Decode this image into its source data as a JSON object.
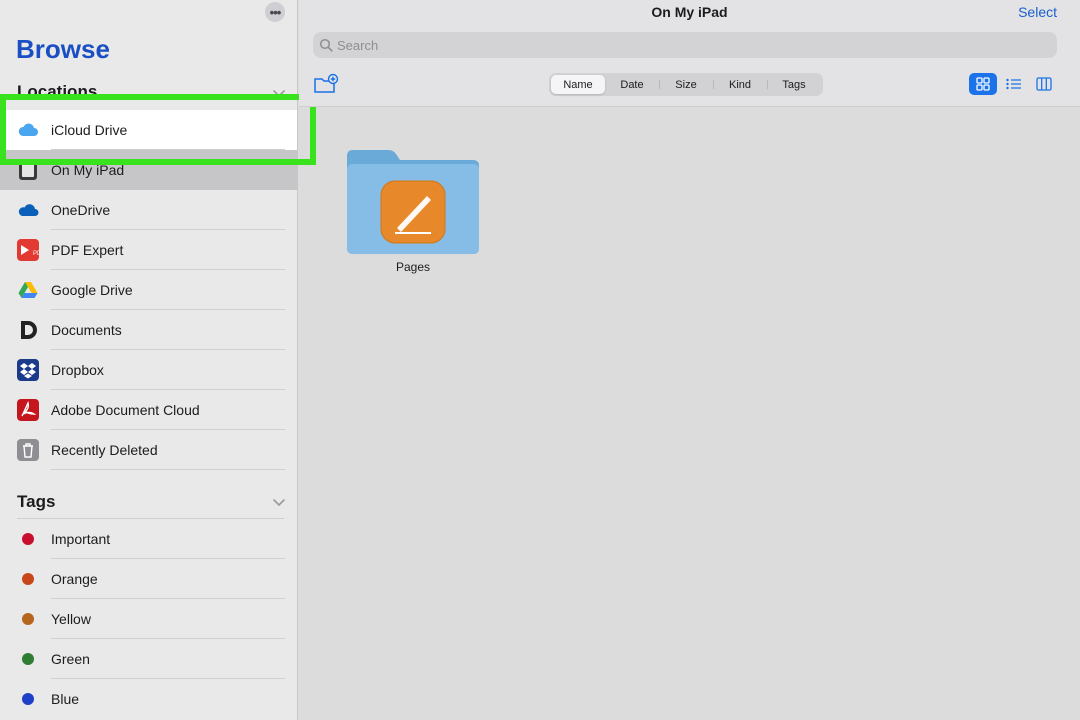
{
  "sidebar": {
    "title": "Browse",
    "more_icon": "ellipsis-icon",
    "locations_header": "Locations",
    "locations": [
      {
        "label": "iCloud Drive",
        "icon": "icloud-icon"
      },
      {
        "label": "On My iPad",
        "icon": "ipad-icon"
      },
      {
        "label": "OneDrive",
        "icon": "onedrive-icon"
      },
      {
        "label": "PDF Expert",
        "icon": "pdf-expert-icon"
      },
      {
        "label": "Google Drive",
        "icon": "google-drive-icon"
      },
      {
        "label": "Documents",
        "icon": "documents-icon"
      },
      {
        "label": "Dropbox",
        "icon": "dropbox-icon"
      },
      {
        "label": "Adobe Document Cloud",
        "icon": "adobe-icon"
      },
      {
        "label": "Recently Deleted",
        "icon": "trash-icon"
      }
    ],
    "selected_location": "On My iPad",
    "tags_header": "Tags",
    "tags": [
      {
        "label": "Important",
        "color": "#c8102e"
      },
      {
        "label": "Orange",
        "color": "#c8471a"
      },
      {
        "label": "Yellow",
        "color": "#b5651d"
      },
      {
        "label": "Green",
        "color": "#2e7d32"
      },
      {
        "label": "Blue",
        "color": "#1e3fc8"
      }
    ]
  },
  "main": {
    "nav_title": "On My iPad",
    "select_label": "Select",
    "search_placeholder": "Search",
    "sort_options": [
      "Name",
      "Date",
      "Size",
      "Kind",
      "Tags"
    ],
    "active_sort": "Name",
    "views": [
      "grid-view-icon",
      "list-view-icon",
      "column-view-icon"
    ],
    "active_view": "grid-view-icon",
    "items": [
      {
        "name": "Pages",
        "icon": "pages-folder-icon"
      }
    ]
  },
  "colors": {
    "accent": "#1a73e8",
    "browse_title": "#1a4fc4",
    "highlight_box": "#38e21d"
  }
}
